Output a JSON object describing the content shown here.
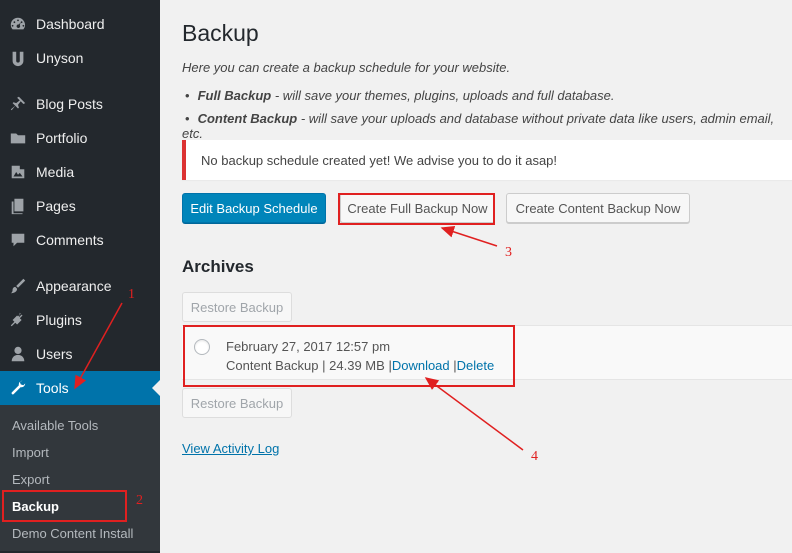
{
  "sidebar": {
    "group1": [
      {
        "label": "Dashboard",
        "icon": "dashboard-icon"
      },
      {
        "label": "Unyson",
        "icon": "unyson-icon"
      }
    ],
    "group2": [
      {
        "label": "Blog Posts",
        "icon": "pin-icon"
      },
      {
        "label": "Portfolio",
        "icon": "folder-icon"
      },
      {
        "label": "Media",
        "icon": "media-icon"
      },
      {
        "label": "Pages",
        "icon": "pages-icon"
      },
      {
        "label": "Comments",
        "icon": "comments-icon"
      }
    ],
    "group3": [
      {
        "label": "Appearance",
        "icon": "brush-icon"
      },
      {
        "label": "Plugins",
        "icon": "plug-icon"
      },
      {
        "label": "Users",
        "icon": "users-icon"
      },
      {
        "label": "Tools",
        "icon": "wrench-icon"
      }
    ],
    "tools_submenu": [
      "Available Tools",
      "Import",
      "Export",
      "Backup",
      "Demo Content Install"
    ]
  },
  "main": {
    "title": "Backup",
    "intro": "Here you can create a backup schedule for your website.",
    "bullets": [
      {
        "name": "Full Backup",
        "desc": " - will save your themes, plugins, uploads and full database."
      },
      {
        "name": "Content Backup",
        "desc": " - will save your uploads and database without private data like users, admin email, etc."
      }
    ],
    "notice": "No backup schedule created yet! We advise you to do it asap!",
    "buttons": {
      "edit_schedule": "Edit Backup Schedule",
      "full_backup": "Create Full Backup Now",
      "content_backup": "Create Content Backup Now"
    },
    "archives_heading": "Archives",
    "restore_label": "Restore Backup",
    "archive": {
      "date": "February 27, 2017 12:57 pm",
      "type": "Content Backup",
      "size": "24.39 MB",
      "download": "Download",
      "delete": "Delete",
      "sep": "|"
    },
    "view_log": "View Activity Log"
  },
  "annotations": [
    "1",
    "2",
    "3",
    "4"
  ],
  "colors": {
    "accent": "#0073aa",
    "annotation": "#e02020",
    "sidebar": "#23282d"
  }
}
